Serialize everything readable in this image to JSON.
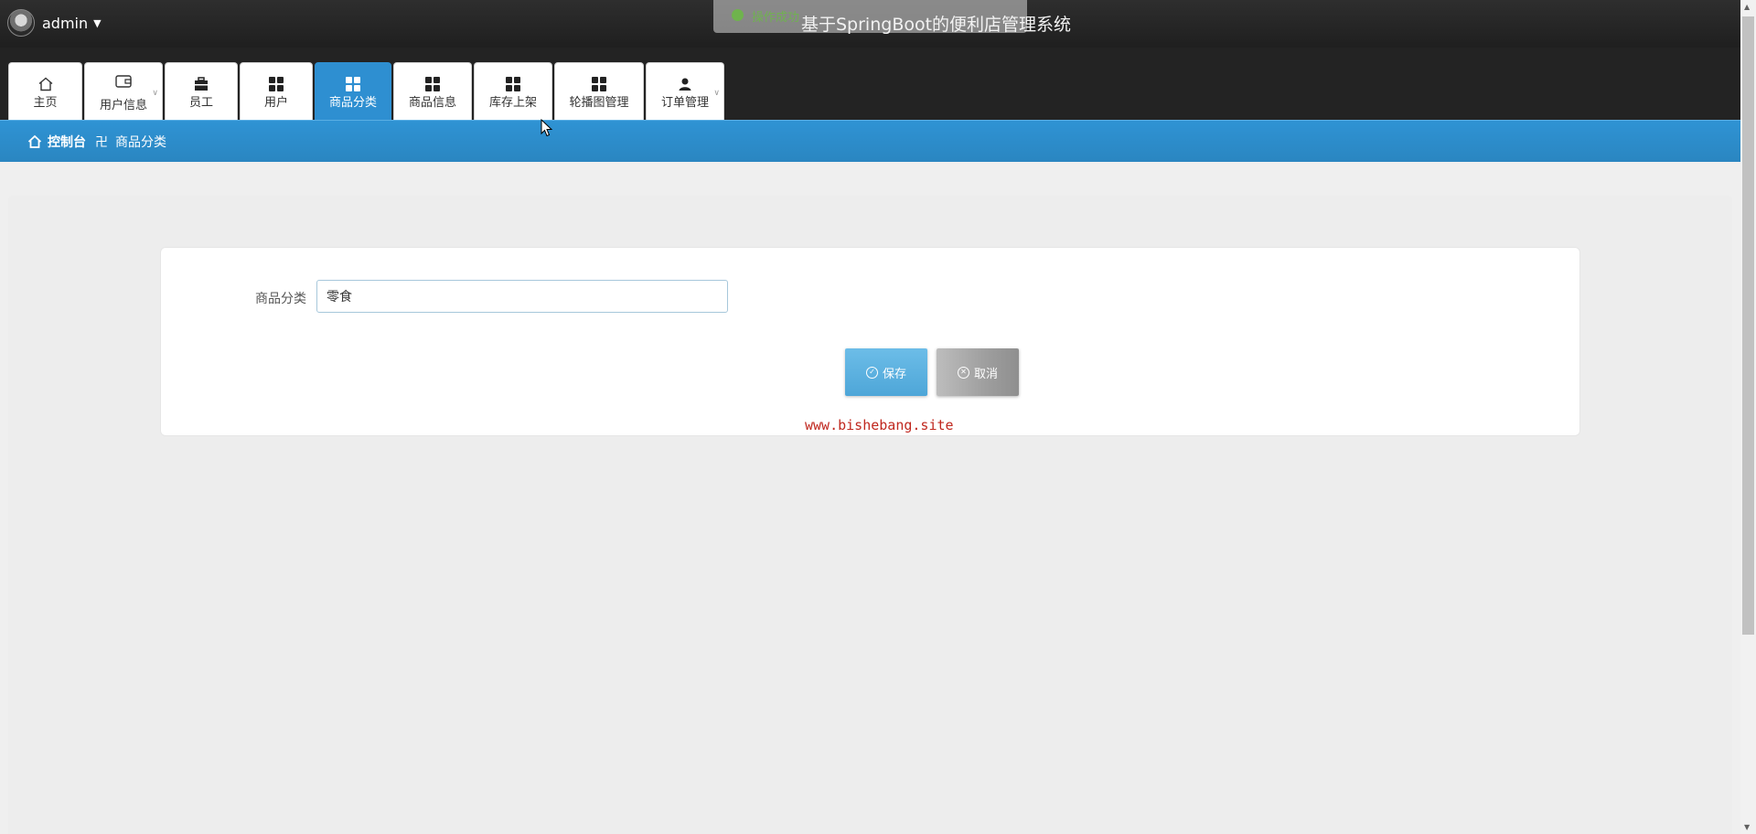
{
  "header": {
    "username": "admin",
    "app_title": "基于SpringBoot的便利店管理系统",
    "toast_message": "操作成功"
  },
  "nav": {
    "tabs": [
      {
        "label": "主页",
        "icon": "home-icon"
      },
      {
        "label": "用户信息",
        "icon": "wallet-icon",
        "has_dropdown": true
      },
      {
        "label": "员工",
        "icon": "briefcase-icon"
      },
      {
        "label": "用户",
        "icon": "grid-icon"
      },
      {
        "label": "商品分类",
        "icon": "grid-icon",
        "active": true
      },
      {
        "label": "商品信息",
        "icon": "grid-icon"
      },
      {
        "label": "库存上架",
        "icon": "grid-icon"
      },
      {
        "label": "轮播图管理",
        "icon": "grid-icon"
      },
      {
        "label": "订单管理",
        "icon": "person-icon",
        "has_dropdown": true
      }
    ]
  },
  "breadcrumb": {
    "home": "控制台",
    "separator": "卍",
    "current": "商品分类"
  },
  "form": {
    "field_label": "商品分类",
    "field_value": "零食",
    "save_label": "保存",
    "cancel_label": "取消"
  },
  "watermark": "www.bishebang.site",
  "colors": {
    "accent": "#2e8fd1",
    "save_button": "#5bb1e0",
    "cancel_button": "#a5a5a5",
    "watermark": "#c0281f"
  }
}
